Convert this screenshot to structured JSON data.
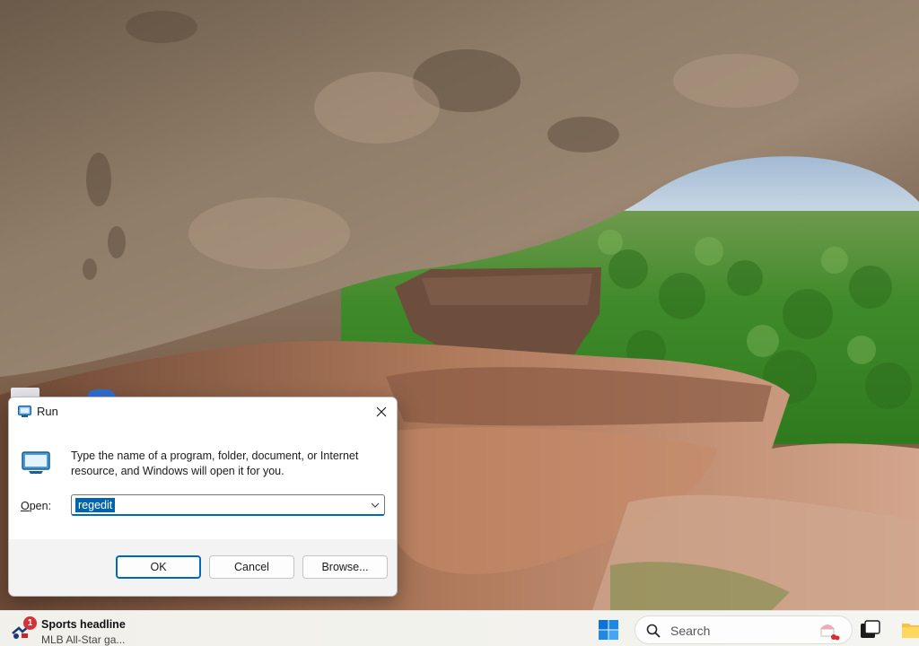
{
  "run_dialog": {
    "title": "Run",
    "description": "Type the name of a program, folder, document, or Internet resource, and Windows will open it for you.",
    "open_label_prefix": "",
    "open_label_accel": "O",
    "open_label_rest": "pen:",
    "open_value": "regedit",
    "ok_label": "OK",
    "cancel_label": "Cancel",
    "browse_label": "Browse..."
  },
  "taskbar": {
    "widget": {
      "badge": "1",
      "title": "Sports headline",
      "subtitle": "MLB All-Star ga..."
    },
    "search_placeholder": "Search",
    "icons": [
      "windows-start-icon",
      "search-icon",
      "task-view-icon",
      "file-explorer-icon"
    ]
  },
  "colors": {
    "accent": "#0067c0",
    "selection": "#0063b1",
    "badge": "#d13438"
  }
}
